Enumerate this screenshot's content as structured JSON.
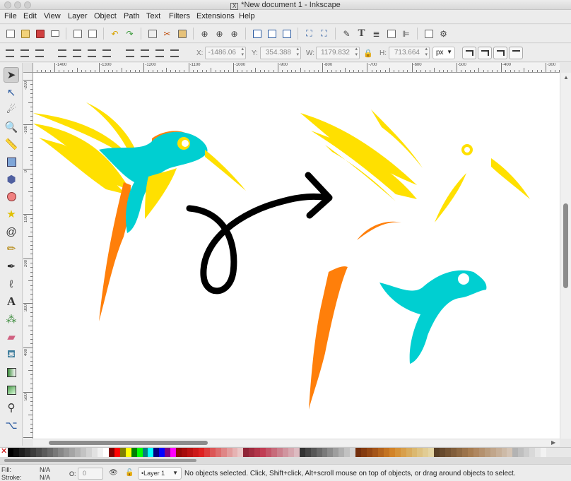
{
  "window": {
    "title": "*New document 1 - Inkscape"
  },
  "menubar": [
    "File",
    "Edit",
    "View",
    "Layer",
    "Object",
    "Path",
    "Text",
    "Filters",
    "Extensions",
    "Help"
  ],
  "toolbar": {
    "x_label": "X:",
    "x_value": "-1486.06",
    "y_label": "Y:",
    "y_value": "354.388",
    "w_label": "W:",
    "w_value": "1179.832",
    "h_label": "H:",
    "h_value": "713.664",
    "unit": "px"
  },
  "ruler": {
    "h_labels": [
      "-1400",
      "-1300",
      "-1200",
      "-1100",
      "-1000",
      "-900",
      "-800",
      "-700",
      "-600",
      "-500",
      "-400",
      "-300"
    ],
    "v_labels": [
      "-200",
      "-100",
      "0",
      "100",
      "200",
      "300",
      "400",
      "500"
    ]
  },
  "status": {
    "fill_label": "Fill:",
    "fill_value": "N/A",
    "stroke_label": "Stroke:",
    "stroke_value": "N/A",
    "opacity_label": "O:",
    "opacity_value": "0",
    "layer": "•Layer 1",
    "message": "No objects selected. Click, Shift+click, Alt+scroll mouse on top of objects, or drag around objects to select."
  },
  "colors": {
    "bird_cyan": "#00cfd1",
    "bird_yellow": "#ffe000",
    "bird_orange": "#ff7f0a",
    "arrow": "#000000"
  },
  "icons": {
    "tools": [
      "selector-icon",
      "node-icon",
      "tweak-icon",
      "zoom-icon",
      "measure-icon",
      "rectangle-icon",
      "3d-box-icon",
      "ellipse-icon",
      "star-icon",
      "spiral-icon",
      "pencil-icon",
      "pen-icon",
      "calligraphy-icon",
      "text-icon",
      "spray-icon",
      "eraser-icon",
      "paint-bucket-icon",
      "gradient-icon",
      "mesh-icon",
      "dropper-icon",
      "connector-icon"
    ]
  }
}
